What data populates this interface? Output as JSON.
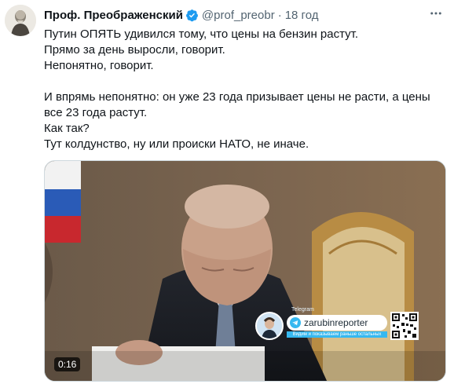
{
  "tweet": {
    "author_name": "Проф. Преображенский",
    "handle": "@prof_preobr",
    "separator": "·",
    "time": "18 год",
    "lines": [
      "Путин ОПЯТЬ удивился тому, что цены на бензин растут.",
      "Прямо за день выросли, говорит.",
      "Непонятно, говорит.",
      "",
      "И впрямь непонятно: он уже 23 года призывает цены не расти, а цены",
      "все 23 года растут.",
      "Как так?",
      "Тут колдунство, ну или происки НАТО, не иначе."
    ]
  },
  "media": {
    "duration": "0:16",
    "overlay": {
      "source_label": "Telegram",
      "channel": "zarubinreporter",
      "tagline": "Видим и показываем раньше остальных"
    }
  },
  "icons": {
    "verified": "verified-badge-icon",
    "more": "more-options-icon",
    "telegram": "telegram-icon",
    "qr": "qr-code-icon"
  },
  "colors": {
    "text": "#0f1419",
    "secondary": "#536471",
    "verified": "#1d9bf0",
    "telegram": "#36b8f0"
  }
}
